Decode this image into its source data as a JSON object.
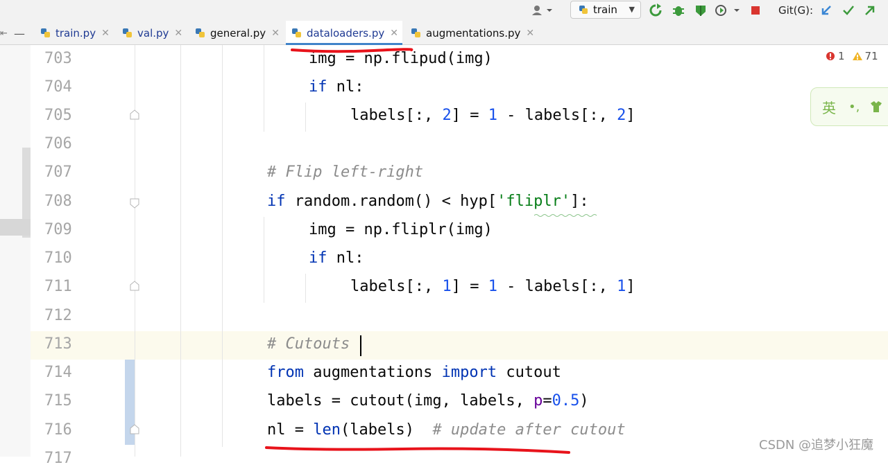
{
  "toolbar": {
    "run_config": "train",
    "git_label": "Git(G):"
  },
  "tabs": [
    {
      "label": "train.py"
    },
    {
      "label": "val.py"
    },
    {
      "label": "general.py"
    },
    {
      "label": "dataloaders.py"
    },
    {
      "label": "augmentations.py"
    }
  ],
  "inspections": {
    "errors": "1",
    "warnings": "71"
  },
  "ime": {
    "lang": "英",
    "punct": "•,"
  },
  "lines": [
    {
      "n": "703"
    },
    {
      "n": "704"
    },
    {
      "n": "705"
    },
    {
      "n": "706"
    },
    {
      "n": "707"
    },
    {
      "n": "708"
    },
    {
      "n": "709"
    },
    {
      "n": "710"
    },
    {
      "n": "711"
    },
    {
      "n": "712"
    },
    {
      "n": "713"
    },
    {
      "n": "714"
    },
    {
      "n": "715"
    },
    {
      "n": "716"
    },
    {
      "n": "717"
    }
  ],
  "code": {
    "l703": {
      "a": "img = np.flipud(img)"
    },
    "l704": {
      "kw": "if",
      "rest": " nl:"
    },
    "l705": {
      "a": "labels[:, ",
      "n1": "2",
      "b": "] = ",
      "n2": "1",
      "c": " - labels[:, ",
      "n3": "2",
      "d": "]"
    },
    "l707": {
      "cmt": "# Flip left-right"
    },
    "l708": {
      "kw": "if",
      "a": " random.random() < hyp[",
      "str": "'fliplr'",
      "b": "]:"
    },
    "l709": {
      "a": "img = np.fliplr(img)"
    },
    "l710": {
      "kw": "if",
      "rest": " nl:"
    },
    "l711": {
      "a": "labels[:, ",
      "n1": "1",
      "b": "] = ",
      "n2": "1",
      "c": " - labels[:, ",
      "n3": "1",
      "d": "]"
    },
    "l713": {
      "cmt": "# Cutouts"
    },
    "l714": {
      "kw1": "from",
      "a": " augmentations ",
      "kw2": "import",
      "b": " cutout"
    },
    "l715": {
      "a": "labels = cutout(img, labels, ",
      "p": "p",
      "b": "=",
      "n": "0.5",
      "c": ")"
    },
    "l716": {
      "a": "nl = ",
      "kw": "len",
      "b": "(labels)  ",
      "cmt": "# update after cutout"
    }
  },
  "watermark": "CSDN @追梦小狂魔",
  "colors": {
    "keyword": "#0033b3",
    "number": "#1750eb",
    "string": "#067d17",
    "comment": "#8c8c8c",
    "annotation_red": "#e8131b"
  }
}
